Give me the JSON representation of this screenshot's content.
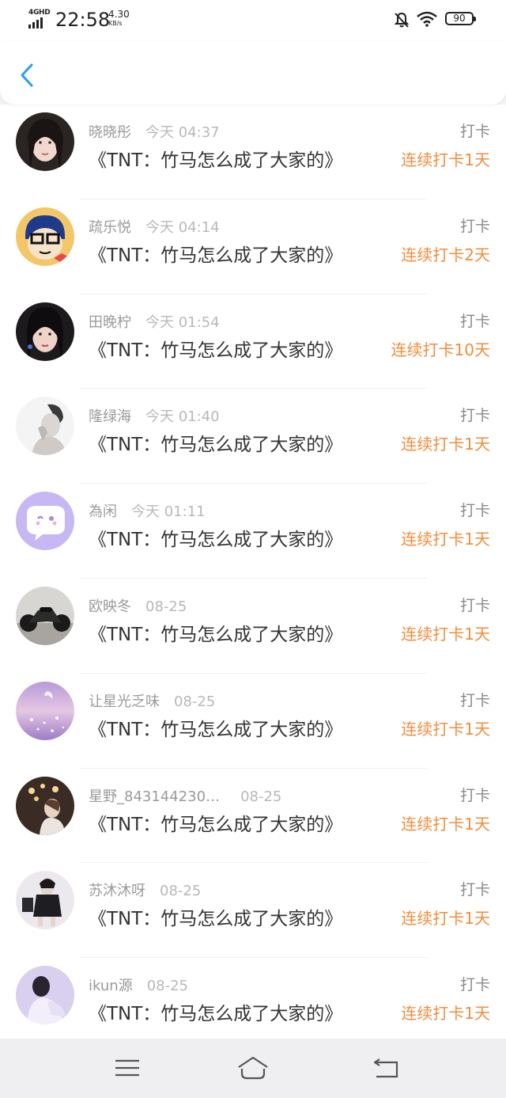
{
  "status_bar": {
    "network": "4GHD",
    "time": "22:58",
    "speed_value": "4.30",
    "speed_unit": "KB/s",
    "battery": "90"
  },
  "header": {
    "back_icon": "chevron-left-icon"
  },
  "colors": {
    "accent": "#2a9df4",
    "streak": "#f28c3c"
  },
  "entries": [
    {
      "user": "晓晓彤",
      "time": "今天 04:37",
      "book": "《TNT：竹马怎么成了大家的》",
      "action": "打卡",
      "streak": "连续打卡1天"
    },
    {
      "user": "疏乐悦",
      "time": "今天 04:14",
      "book": "《TNT：竹马怎么成了大家的》",
      "action": "打卡",
      "streak": "连续打卡2天"
    },
    {
      "user": "田晚柠",
      "time": "今天 01:54",
      "book": "《TNT：竹马怎么成了大家的》",
      "action": "打卡",
      "streak": "连续打卡10天"
    },
    {
      "user": "隆绿海",
      "time": "今天 01:40",
      "book": "《TNT：竹马怎么成了大家的》",
      "action": "打卡",
      "streak": "连续打卡1天"
    },
    {
      "user": "為闲",
      "time": "今天 01:11",
      "book": "《TNT：竹马怎么成了大家的》",
      "action": "打卡",
      "streak": "连续打卡1天"
    },
    {
      "user": "欧映冬",
      "time": "08-25",
      "book": "《TNT：竹马怎么成了大家的》",
      "action": "打卡",
      "streak": "连续打卡1天"
    },
    {
      "user": "让星光乏味",
      "time": "08-25",
      "book": "《TNT：竹马怎么成了大家的》",
      "action": "打卡",
      "streak": "连续打卡1天"
    },
    {
      "user": "星野_843144230…",
      "time": "08-25",
      "book": "《TNT：竹马怎么成了大家的》",
      "action": "打卡",
      "streak": "连续打卡1天"
    },
    {
      "user": "苏沐沐呀",
      "time": "08-25",
      "book": "《TNT：竹马怎么成了大家的》",
      "action": "打卡",
      "streak": "连续打卡1天"
    },
    {
      "user": "ikun源",
      "time": "08-25",
      "book": "《TNT：竹马怎么成了大家的》",
      "action": "打卡",
      "streak": "连续打卡1天"
    }
  ],
  "nav_bar": {
    "icons": [
      "menu-icon",
      "home-icon",
      "back-icon"
    ]
  }
}
